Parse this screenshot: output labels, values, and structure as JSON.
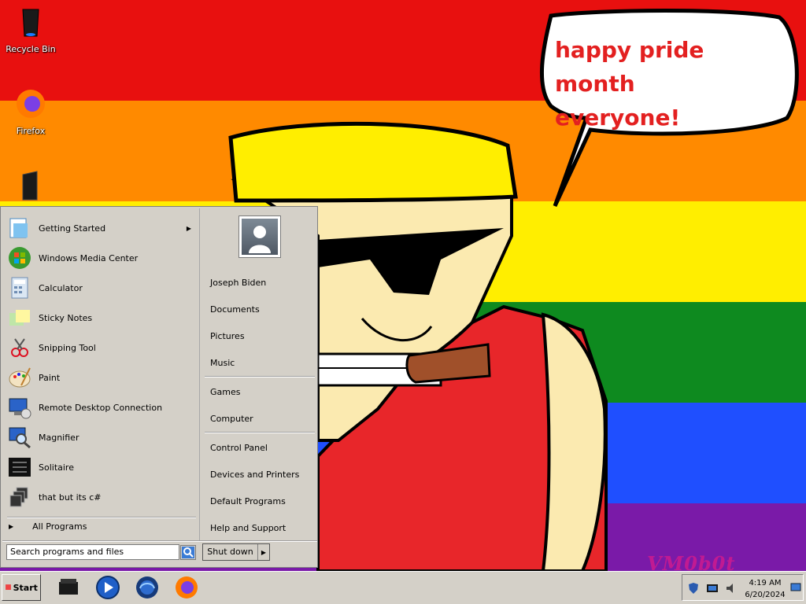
{
  "desktop": {
    "icons": [
      {
        "label": "Recycle Bin",
        "icon": "recycle-bin-icon"
      },
      {
        "label": "Firefox",
        "icon": "firefox-icon"
      },
      {
        "label": "",
        "icon": "folder-icon"
      }
    ],
    "speech_bubble": {
      "line1": "happy pride month",
      "line2": "everyone!",
      "color": "#e32020"
    },
    "watermark": "VM0b0t",
    "flag_colors": [
      "#e8100f",
      "#ff8a00",
      "#ffee00",
      "#0e8a1f",
      "#1f4fff",
      "#7a1aa8"
    ]
  },
  "start_menu": {
    "programs": [
      {
        "label": "Getting Started",
        "icon": "getting-started-icon",
        "has_submenu": true
      },
      {
        "label": "Windows Media Center",
        "icon": "media-center-icon"
      },
      {
        "label": "Calculator",
        "icon": "calculator-icon"
      },
      {
        "label": "Sticky Notes",
        "icon": "sticky-notes-icon"
      },
      {
        "label": "Snipping Tool",
        "icon": "snipping-tool-icon"
      },
      {
        "label": "Paint",
        "icon": "paint-icon"
      },
      {
        "label": "Remote Desktop Connection",
        "icon": "remote-desktop-icon"
      },
      {
        "label": "Magnifier",
        "icon": "magnifier-icon"
      },
      {
        "label": "Solitaire",
        "icon": "solitaire-icon"
      },
      {
        "label": "that but its c#",
        "icon": "windows-stack-icon"
      }
    ],
    "all_programs": "All Programs",
    "search_placeholder": "Search programs and files",
    "user_name": "Joseph Biden",
    "links": [
      "Documents",
      "Pictures",
      "Music",
      "Games",
      "Computer",
      "Control Panel",
      "Devices and Printers",
      "Default Programs",
      "Help and Support"
    ],
    "shutdown_label": "Shut down"
  },
  "taskbar": {
    "start_label": "Start",
    "pinned": [
      "explorer-icon",
      "media-player-icon",
      "internet-explorer-icon",
      "firefox-icon"
    ],
    "tray_icons": [
      "shield-icon",
      "network-icon",
      "volume-icon"
    ],
    "time": "4:19 AM",
    "date": "6/20/2024"
  }
}
